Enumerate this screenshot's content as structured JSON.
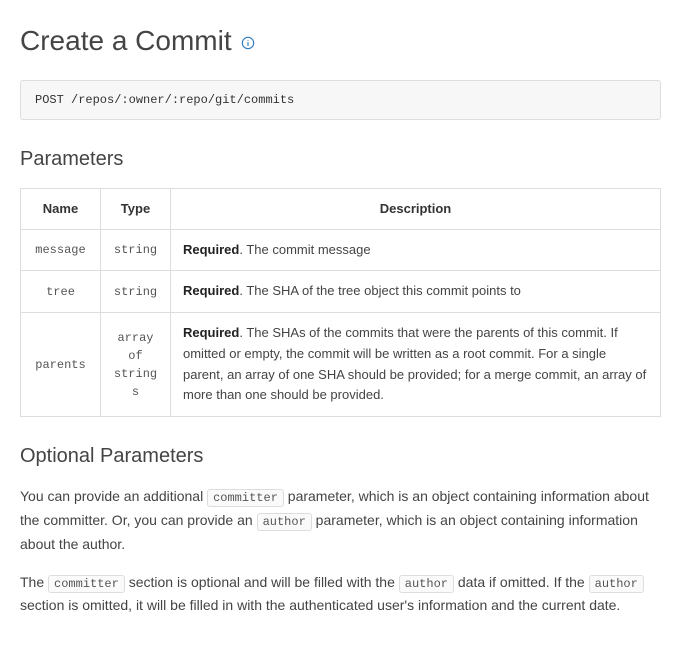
{
  "title": "Create a Commit",
  "endpoint": "POST /repos/:owner/:repo/git/commits",
  "sections": {
    "params_heading": "Parameters",
    "optional_heading": "Optional Parameters"
  },
  "table": {
    "headers": {
      "name": "Name",
      "type": "Type",
      "desc": "Description"
    },
    "rows": [
      {
        "name": "message",
        "type": "string",
        "required": "Required",
        "desc": ". The commit message"
      },
      {
        "name": "tree",
        "type": "string",
        "required": "Required",
        "desc": ". The SHA of the tree object this commit points to"
      },
      {
        "name": "parents",
        "type": "array\nof\nstring s",
        "required": "Required",
        "desc": ". The SHAs of the commits that were the parents of this commit. If omitted or empty, the commit will be written as a root commit. For a single parent, an array of one SHA should be provided; for a merge commit, an array of more than one should be provided."
      }
    ]
  },
  "optional": {
    "p1_a": "You can provide an additional ",
    "code1": "committer",
    "p1_b": " parameter, which is an object containing information about the committer. Or, you can provide an ",
    "code2": "author",
    "p1_c": " parameter, which is an object containing information about the author.",
    "p2_a": "The ",
    "code3": "committer",
    "p2_b": " section is optional and will be filled with the ",
    "code4": "author",
    "p2_c": " data if omitted. If the ",
    "code5": "author",
    "p2_d": " section is omitted, it will be filled in with the authenticated user's information and the current date."
  }
}
